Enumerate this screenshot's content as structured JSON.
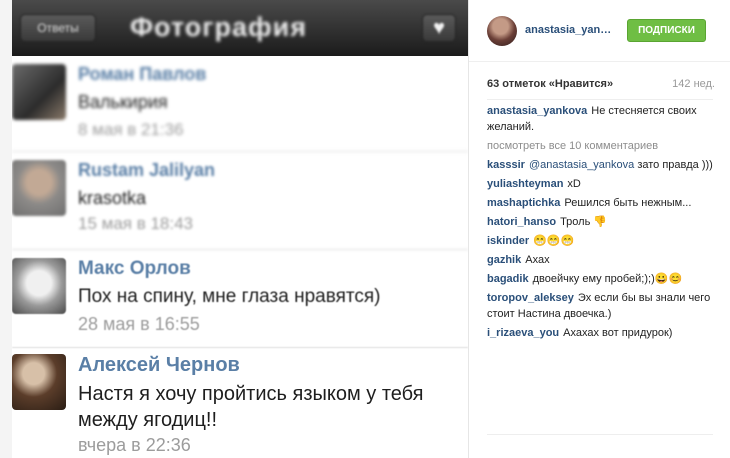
{
  "photo": {
    "navbar": {
      "back_label": "Ответы",
      "title": "Фотография",
      "heart_icon": "heart-icon"
    },
    "comments": [
      {
        "name": "Роман Павлов",
        "text": "Валькирия",
        "time": "8 мая в 21:36"
      },
      {
        "name": "Rustam Jalilyan",
        "text": "krasotka",
        "time": "15 мая в 18:43"
      },
      {
        "name": "Макс Орлов",
        "text": "Пох на спину, мне глаза нравятся)",
        "time": "28 мая в 16:55"
      },
      {
        "name": "Алексей Чернов",
        "text": "Настя я хочу пройтись языком у тебя",
        "text2": "между ягодиц!!",
        "time": "вчера в 22:36"
      }
    ]
  },
  "panel": {
    "username": "anastasia_yankova",
    "username_shown": "anastasia_yank...",
    "follow_label": "ПОДПИСКИ",
    "likes": "63 отметок «Нравится»",
    "age": "142 нед.",
    "caption_user": "anastasia_yankova",
    "caption_text": "Не стесняется своих желаний.",
    "view_all": "посмотреть все 10 комментариев",
    "comments": [
      {
        "user": "kasssir",
        "mention": "@anastasia_yankova",
        "text": "зато правда )))"
      },
      {
        "user": "yuliashteyman",
        "text": "xD"
      },
      {
        "user": "mashaptichka",
        "text": "Решился быть нежным..."
      },
      {
        "user": "hatori_hanso",
        "text": "Троль 👎"
      },
      {
        "user": "iskinder",
        "text": "😁😁😁"
      },
      {
        "user": "gazhik",
        "text": "Ахах"
      },
      {
        "user": "bagadik",
        "text": "двоейчку ему пробей;);)😀😊"
      },
      {
        "user": "toropov_aleksey",
        "text": "Эх если бы вы знали чего стоит Настина двоечка.)"
      },
      {
        "user": "i_rizaeva_you",
        "text": "Ахахах вот придурок)"
      }
    ]
  },
  "colors": {
    "accent_link": "#2a4f79",
    "follow_button": "#6fbe44",
    "comment_name": "#5a7fa6"
  }
}
